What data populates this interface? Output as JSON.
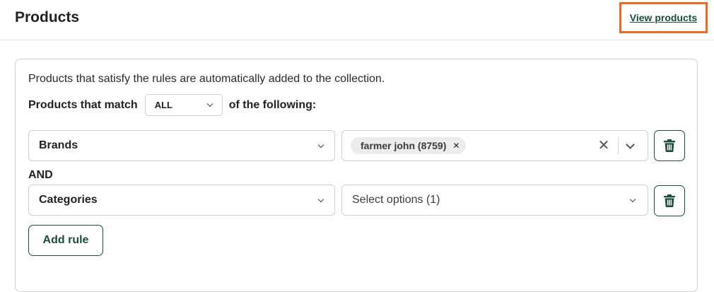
{
  "header": {
    "title": "Products",
    "view_link": "View products"
  },
  "card": {
    "description": "Products that satisfy the rules are automatically added to the collection.",
    "match_prefix": "Products that match",
    "match_value": "ALL",
    "match_suffix": "of the following:"
  },
  "rules": [
    {
      "field": "Brands",
      "selected_chips": [
        "farmer john (8759)"
      ],
      "chip_remove_icon": "x-icon",
      "clear_icon": "close-icon",
      "dropdown_icon": "chevron-down-icon",
      "delete_icon": "trash-icon"
    },
    {
      "connector": "AND",
      "field": "Categories",
      "value_placeholder": "Select options (1)",
      "dropdown_icon": "chevron-down-icon",
      "delete_icon": "trash-icon"
    }
  ],
  "add_rule_label": "Add rule",
  "colors": {
    "accent": "#1b4d3e",
    "highlight_border": "#ee6a1e",
    "border": "#cfcfcf",
    "chip_bg": "#ececec"
  }
}
